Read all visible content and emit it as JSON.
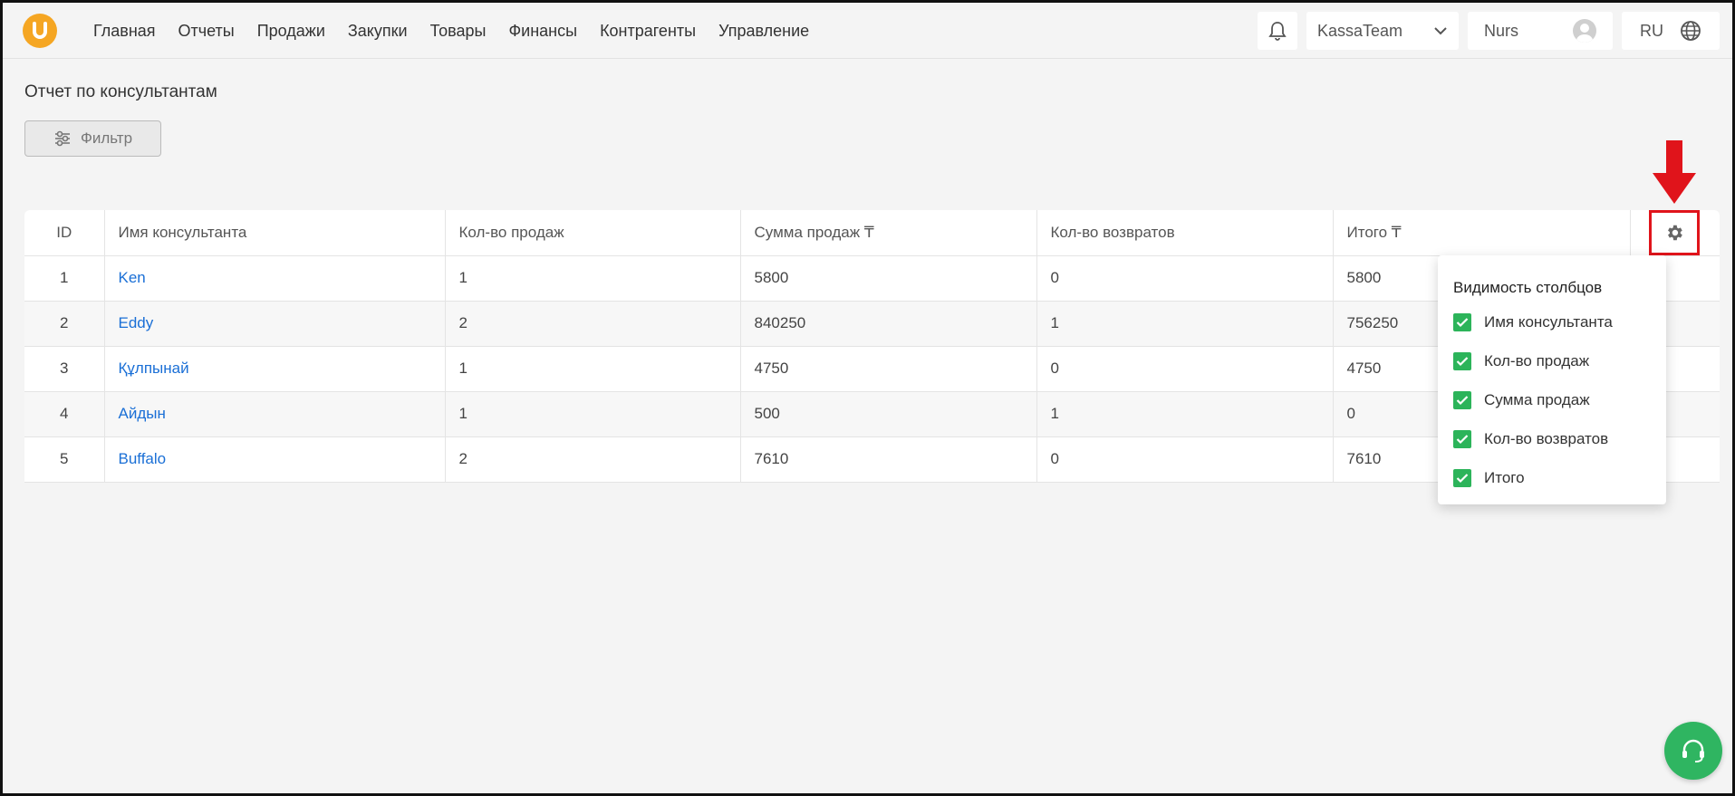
{
  "nav": {
    "items": [
      "Главная",
      "Отчеты",
      "Продажи",
      "Закупки",
      "Товары",
      "Финансы",
      "Контрагенты",
      "Управление"
    ]
  },
  "topbar": {
    "team": "KassaTeam",
    "user": "Nurs",
    "lang": "RU"
  },
  "page": {
    "title": "Отчет по консультантам",
    "filter_label": "Фильтр"
  },
  "table": {
    "headers": [
      "ID",
      "Имя консультанта",
      "Кол-во продаж",
      "Сумма продаж ₸",
      "Кол-во возвратов",
      "Итого ₸"
    ],
    "rows": [
      {
        "id": "1",
        "name": "Ken",
        "count": "1",
        "sum": "5800",
        "returns": "0",
        "total": "5800"
      },
      {
        "id": "2",
        "name": "Eddy",
        "count": "2",
        "sum": "840250",
        "returns": "1",
        "total": "756250"
      },
      {
        "id": "3",
        "name": "Құлпынай",
        "count": "1",
        "sum": "4750",
        "returns": "0",
        "total": "4750"
      },
      {
        "id": "4",
        "name": "Айдын",
        "count": "1",
        "sum": "500",
        "returns": "1",
        "total": "0"
      },
      {
        "id": "5",
        "name": "Buffalo",
        "count": "2",
        "sum": "7610",
        "returns": "0",
        "total": "7610"
      }
    ]
  },
  "column_visibility": {
    "title": "Видимость столбцов",
    "options": [
      "Имя консультанта",
      "Кол-во продаж",
      "Сумма продаж",
      "Кол-во возвратов",
      "Итого"
    ]
  },
  "colors": {
    "brand": "#f5a623",
    "link": "#1a6fd6",
    "check": "#2cb45a",
    "highlight": "#e0141b",
    "support": "#2fb561"
  }
}
